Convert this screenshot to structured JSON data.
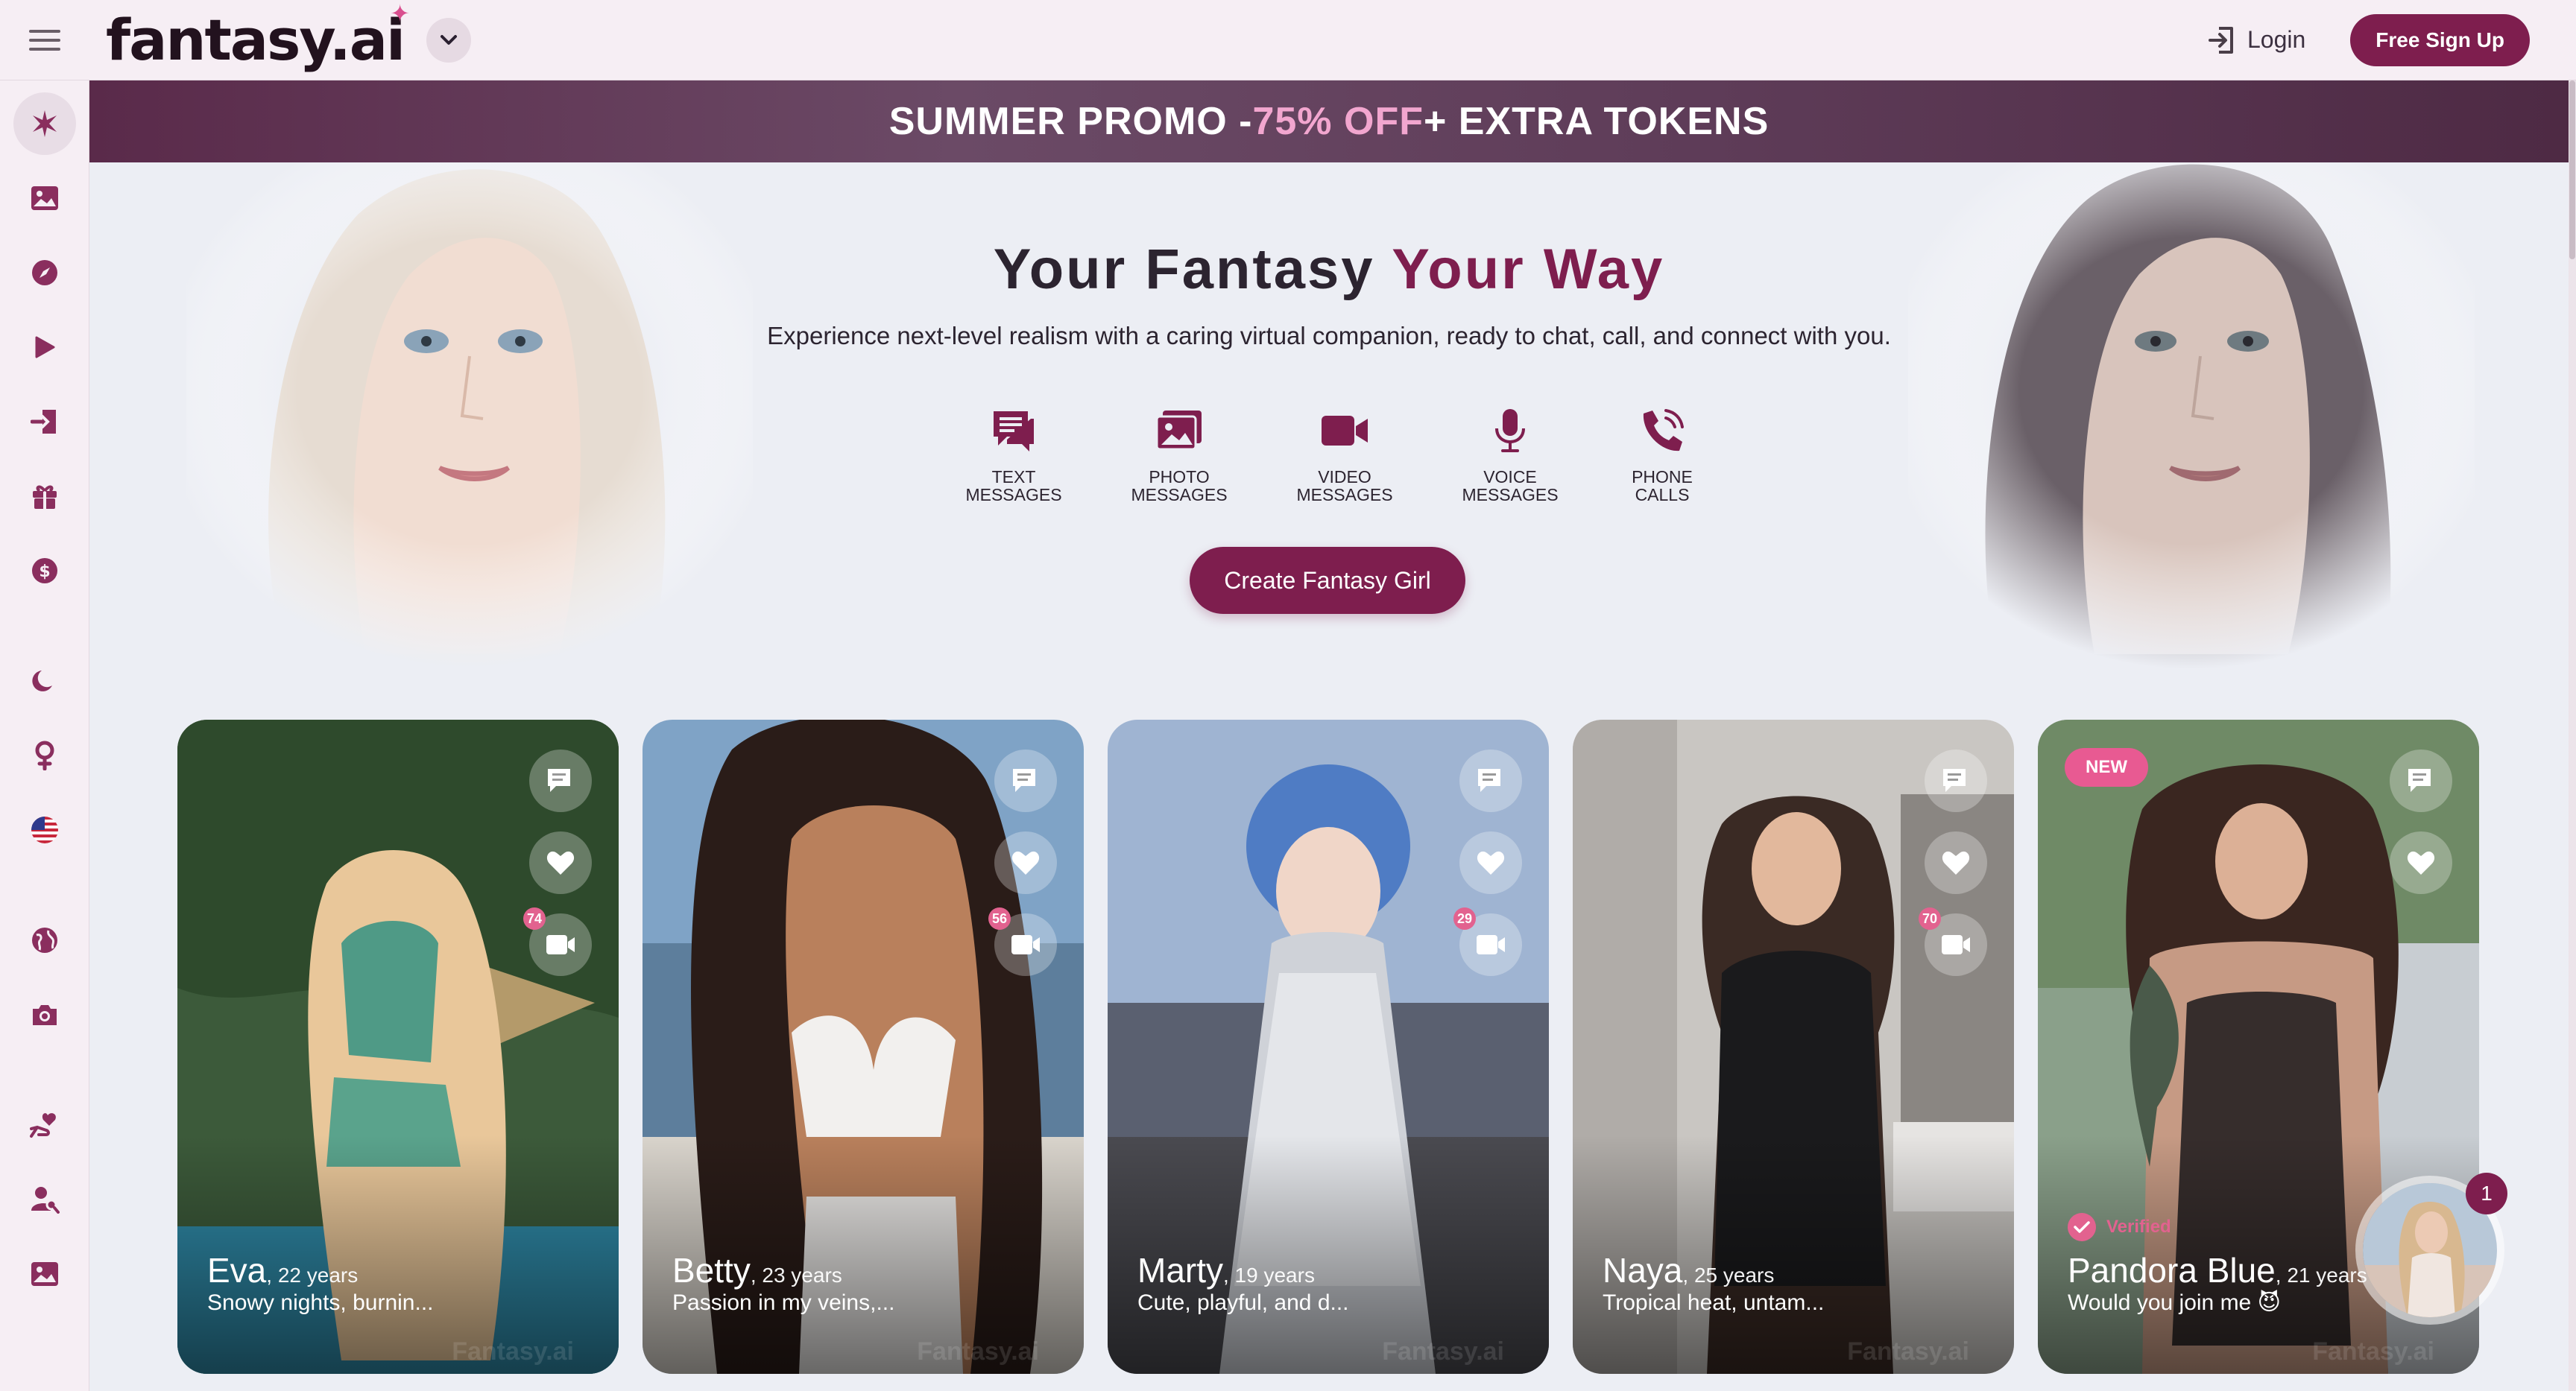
{
  "app": {
    "logo_text": "fantasy.ai"
  },
  "topbar": {
    "login_label": "Login",
    "signup_label": "Free Sign Up"
  },
  "sidebar": {
    "items": [
      {
        "icon": "sparkle-icon"
      },
      {
        "icon": "gallery-icon"
      },
      {
        "icon": "compass-icon"
      },
      {
        "icon": "play-icon"
      },
      {
        "icon": "login-icon"
      },
      {
        "icon": "gift-icon"
      },
      {
        "icon": "dollar-icon"
      },
      {
        "icon": "moon-icon"
      },
      {
        "icon": "female-icon"
      },
      {
        "icon": "us-flag-icon"
      },
      {
        "icon": "globe-icon"
      },
      {
        "icon": "camera-icon"
      },
      {
        "icon": "heart-hand-icon"
      },
      {
        "icon": "user-search-icon"
      },
      {
        "icon": "image-icon"
      }
    ]
  },
  "promo": {
    "part1": "SUMMER PROMO - ",
    "highlight": "75% OFF",
    "part2": " + EXTRA TOKENS"
  },
  "hero": {
    "title_main": "Your Fantasy ",
    "title_accent": "Your Way",
    "subtitle": "Experience next-level realism with a caring virtual companion, ready to chat, call, and connect with you.",
    "features": [
      {
        "label": "TEXT\nMESSAGES",
        "icon": "text-message-icon"
      },
      {
        "label": "PHOTO\nMESSAGES",
        "icon": "photo-message-icon"
      },
      {
        "label": "VIDEO\nMESSAGES",
        "icon": "video-message-icon"
      },
      {
        "label": "VOICE\nMESSAGES",
        "icon": "microphone-icon"
      },
      {
        "label": "PHONE\nCALLS",
        "icon": "phone-icon"
      }
    ],
    "cta_label": "Create Fantasy Girl"
  },
  "cards": [
    {
      "name": "Eva",
      "age": ", 22 years",
      "desc": "Snowy nights, burnin...",
      "video_count": "74"
    },
    {
      "name": "Betty",
      "age": ", 23 years",
      "desc": "Passion in my veins,...",
      "video_count": "56"
    },
    {
      "name": "Marty",
      "age": ", 19 years",
      "desc": "Cute, playful, and d...",
      "video_count": "29"
    },
    {
      "name": "Naya",
      "age": ", 25 years",
      "desc": "Tropical heat, untam...",
      "video_count": "70"
    },
    {
      "name": "Pandora Blue",
      "age": ", 21 years",
      "desc": "Would you join me 😈",
      "badge": "NEW",
      "verified_label": "Verified"
    }
  ],
  "card_watermark": "Fantasy.ai",
  "floating_chat": {
    "unread_count": "1"
  },
  "colors": {
    "brand": "#7e1e4e",
    "accent_pink": "#e2628f",
    "promo_highlight": "#f2a6cf"
  }
}
